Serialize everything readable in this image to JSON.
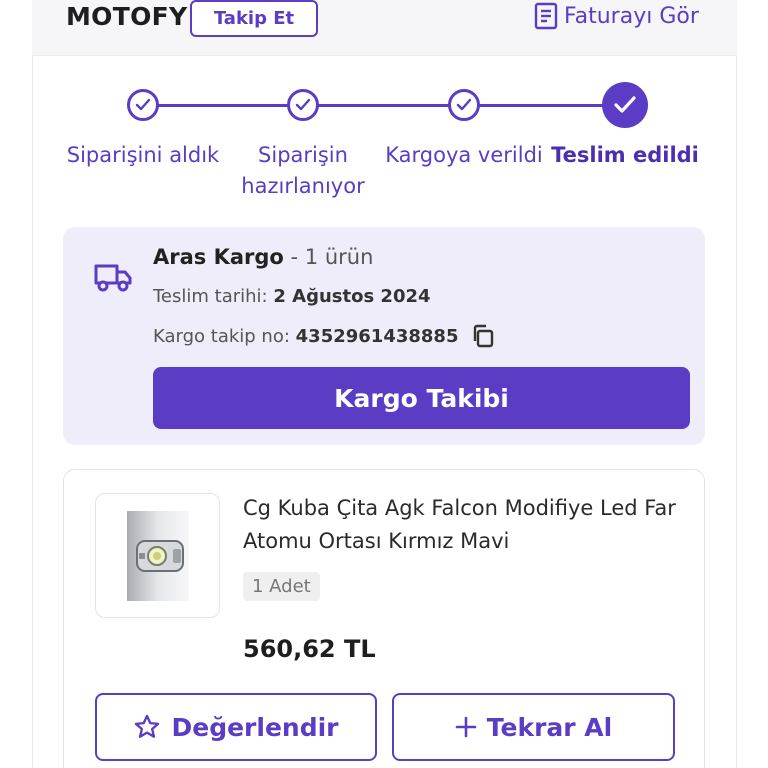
{
  "header": {
    "store_name": "MOTOFY",
    "follow_label": "Takip Et",
    "invoice_label": "Faturayı Gör",
    "invoice_icon": "document-icon"
  },
  "steps": [
    {
      "label": "Siparişini aldık",
      "status": "completed"
    },
    {
      "label": "Siparişin hazırlanıyor",
      "status": "completed"
    },
    {
      "label": "Kargoya verildi",
      "status": "completed"
    },
    {
      "label": "Teslim edildi",
      "status": "current"
    }
  ],
  "shipment": {
    "carrier": "Aras Kargo",
    "item_count": "- 1 ürün",
    "delivery_date_label": "Teslim tarihi:",
    "delivery_date": "2 Ağustos 2024",
    "tracking_label": "Kargo takip no:",
    "tracking_number": "4352961438885",
    "track_button": "Kargo Takibi",
    "truck_icon": "truck-icon",
    "copy_icon": "copy-icon"
  },
  "product": {
    "title": "Cg Kuba Çita Agk Falcon Modifiye Led Far Atomu Ortası Kırmız Mavi",
    "quantity": "1 Adet",
    "price": "560,62 TL",
    "rate_button": "Değerlendir",
    "rate_icon": "star-icon",
    "reorder_button": "Tekrar Al",
    "reorder_icon": "plus-icon"
  },
  "colors": {
    "accent": "#5b3cc4",
    "cargo_bg": "#efedf9"
  }
}
